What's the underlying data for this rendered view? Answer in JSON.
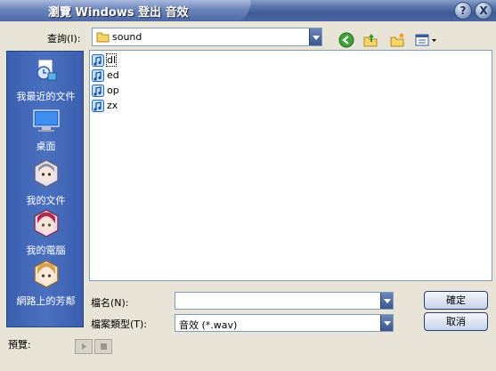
{
  "window": {
    "title": "瀏覽 Windows 登出 音效"
  },
  "titlebar_buttons": {
    "help": "?",
    "close": "X"
  },
  "lookin": {
    "label": "查詢(I):",
    "value": "sound"
  },
  "places": [
    {
      "label": "我最近的文件",
      "icon": "recent-documents-icon"
    },
    {
      "label": "桌面",
      "icon": "desktop-icon"
    },
    {
      "label": "我的文件",
      "icon": "my-documents-icon"
    },
    {
      "label": "我的電腦",
      "icon": "my-computer-icon"
    },
    {
      "label": "網路上的芳鄰",
      "icon": "network-places-icon"
    }
  ],
  "files": [
    "dl",
    "ed",
    "op",
    "zx"
  ],
  "filename": {
    "label": "檔名(N):",
    "value": ""
  },
  "filetype": {
    "label": "檔案類型(T):",
    "value": "音效 (*.wav)"
  },
  "buttons": {
    "ok": "確定",
    "cancel": "取消"
  },
  "preview": {
    "label": "預覽:"
  }
}
